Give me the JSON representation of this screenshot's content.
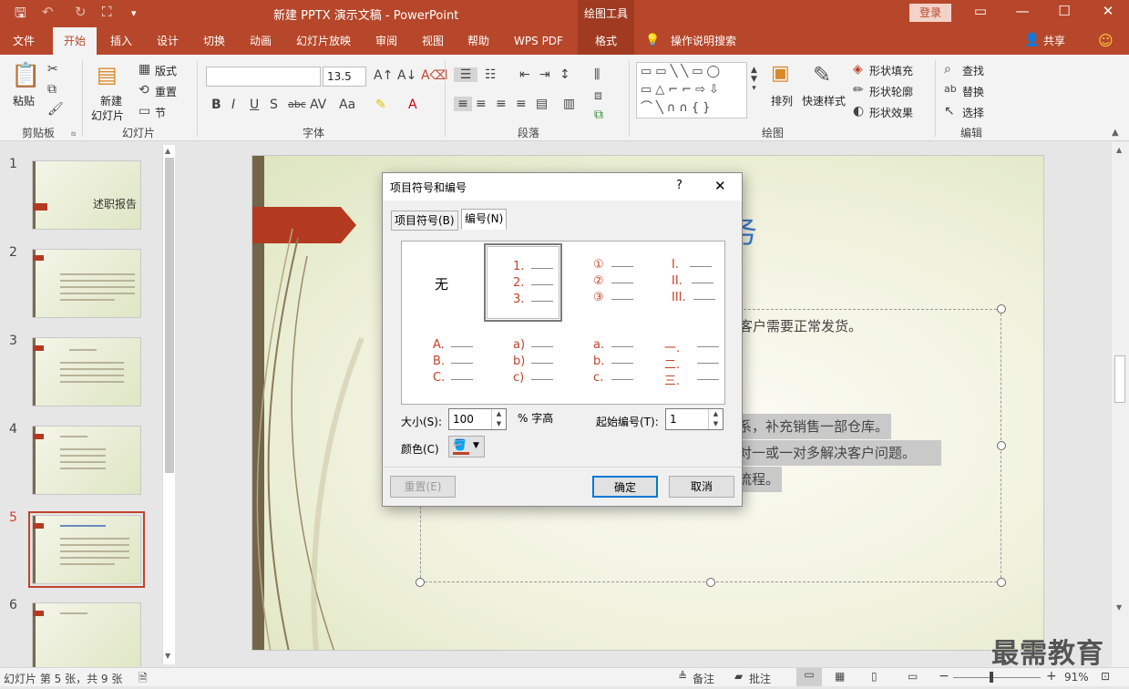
{
  "app": {
    "window_title": "新建 PPTX 演示文稿 - PowerPoint",
    "context_tool": "绘图工具",
    "login": "登录",
    "minimize": "—",
    "restore": "☐",
    "close": "✕"
  },
  "tabs": [
    "文件",
    "开始",
    "插入",
    "设计",
    "切换",
    "动画",
    "幻灯片放映",
    "审阅",
    "视图",
    "帮助",
    "WPS PDF",
    "格式"
  ],
  "tell_me": "操作说明搜索",
  "share": "共享",
  "ribbon": {
    "clipboard": {
      "label": "剪贴板",
      "paste": "粘贴"
    },
    "slides": {
      "label": "幻灯片",
      "new_slide_1": "新建",
      "new_slide_2": "幻灯片",
      "layout": "版式",
      "reset": "重置",
      "section": "节"
    },
    "font": {
      "label": "字体",
      "font_name": "",
      "font_size": "13.5"
    },
    "paragraph": {
      "label": "段落"
    },
    "drawing": {
      "label": "绘图",
      "arrange": "排列",
      "quick_styles": "快速样式",
      "shape_fill": "形状填充",
      "shape_outline": "形状轮廓",
      "shape_effects": "形状效果"
    },
    "editing": {
      "label": "编辑",
      "find": "查找",
      "replace": "替换",
      "select": "选择"
    }
  },
  "thumbnails": [
    {
      "num": "1",
      "title": "述职报告"
    },
    {
      "num": "2",
      "title": ""
    },
    {
      "num": "3",
      "title": ""
    },
    {
      "num": "4",
      "title": ""
    },
    {
      "num": "5",
      "title": ""
    },
    {
      "num": "6",
      "title": ""
    }
  ],
  "slide": {
    "title_partial": "务",
    "line1": "客户需要正常发货。",
    "line2": "系，补充销售一部仓库。",
    "line3": "对一或一对多解决客户问题。",
    "line4": "流程。"
  },
  "dialog": {
    "title": "项目符号和编号",
    "help": "?",
    "close": "✕",
    "tab_bullets": "项目符号(B)",
    "tab_numbering": "编号(N)",
    "none": "无",
    "styles": [
      [
        "1.",
        "2.",
        "3."
      ],
      [
        "①",
        "②",
        "③"
      ],
      [
        "I.",
        "II.",
        "III."
      ],
      [
        "A.",
        "B.",
        "C."
      ],
      [
        "a)",
        "b)",
        "c)"
      ],
      [
        "a.",
        "b.",
        "c."
      ],
      [
        "一.",
        "二.",
        "三."
      ]
    ],
    "size_label": "大小(S):",
    "size_value": "100",
    "size_unit": "% 字高",
    "start_label": "起始编号(T):",
    "start_value": "1",
    "color_label": "颜色(C)",
    "reset": "重置(E)",
    "ok": "确定",
    "cancel": "取消"
  },
  "status": {
    "slide_info": "幻灯片 第 5 张，共 9 张",
    "notes": "备注",
    "comments": "批注",
    "zoom": "91%"
  },
  "watermark": "最需教育",
  "colors": {
    "accent": "#b7472a",
    "number_red": "#c0432a"
  }
}
